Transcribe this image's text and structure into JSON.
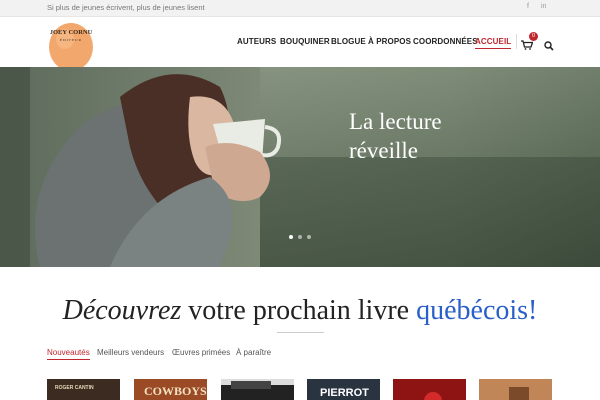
{
  "topbar": {
    "tagline": "Si plus de jeunes écrivent, plus de jeunes lisent",
    "social": [
      "f",
      "in"
    ]
  },
  "logo": {
    "line1": "JOEY CORNU",
    "line2": "ÉDITEUR"
  },
  "nav": {
    "items": [
      "AUTEURS",
      "BOUQUINER",
      "BLOGUE",
      "À PROPOS",
      "COORDONNÉES",
      "ACCUEIL"
    ],
    "active": "ACCUEIL",
    "cart_count": "0"
  },
  "hero": {
    "line1": "La lecture",
    "line2": "réveille",
    "slides": 3,
    "active_slide": 1
  },
  "section": {
    "headline_italic": "Découvrez",
    "headline_mid": " votre prochain livre ",
    "headline_blue": "québécois!"
  },
  "tabs": {
    "items": [
      "Nouveautés",
      "Meilleurs vendeurs",
      "Œuvres primées",
      "À paraître"
    ],
    "active": "Nouveautés"
  },
  "books": [
    {
      "text": "ROGER CANTIN"
    },
    {
      "text": "COWBOYS"
    },
    {
      "text": ""
    },
    {
      "text": "PIERROT"
    },
    {
      "text": ""
    },
    {
      "text": ""
    }
  ],
  "colors": {
    "accent": "#c0262d",
    "headline_blue": "#2a5fc9"
  }
}
